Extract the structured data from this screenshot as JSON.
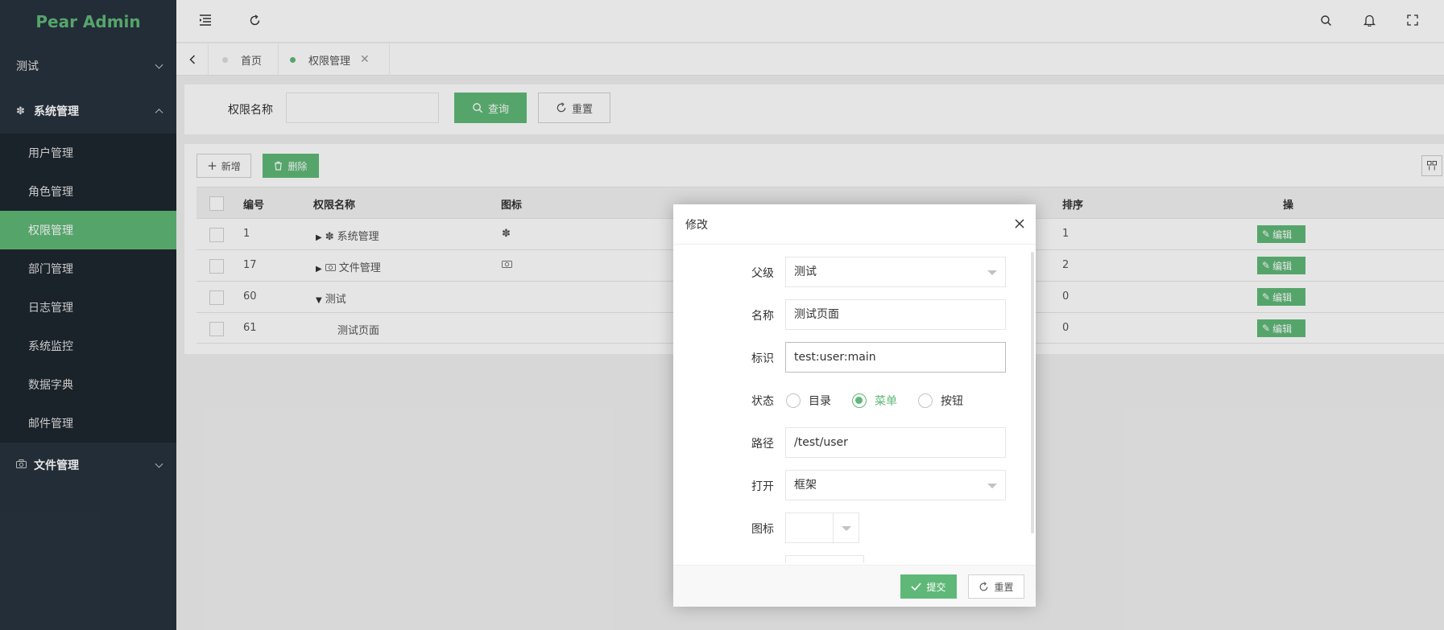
{
  "sidebar": {
    "logo": "Pear Admin",
    "groups": [
      {
        "label": "测试",
        "icon": "none"
      },
      {
        "label": "系统管理",
        "icon": "gear-icon"
      },
      {
        "label": "文件管理",
        "icon": "camera-icon"
      }
    ],
    "items": [
      "用户管理",
      "角色管理",
      "权限管理",
      "部门管理",
      "日志管理",
      "系统监控",
      "数据字典",
      "邮件管理"
    ],
    "active_item": "权限管理"
  },
  "header": {
    "icons": [
      "menu-toggle-icon",
      "refresh-icon",
      "search-icon",
      "bell-icon",
      "fullscreen-icon"
    ]
  },
  "tabs": [
    {
      "label": "首页",
      "active": false
    },
    {
      "label": "权限管理",
      "active": true
    }
  ],
  "search": {
    "label": "权限名称",
    "value": "",
    "query_label": "查询",
    "reset_label": "重置"
  },
  "toolbar": {
    "add_label": "新增",
    "delete_label": "删除"
  },
  "table": {
    "headers": [
      "编号",
      "权限名称",
      "图标",
      "排序",
      "操"
    ],
    "rows": [
      {
        "id": "1",
        "name": "系统管理",
        "icon": "gear-icon",
        "sort": "1",
        "action": "编辑"
      },
      {
        "id": "17",
        "name": "文件管理",
        "icon": "camera-icon",
        "sort": "2",
        "action": "编辑"
      },
      {
        "id": "60",
        "name": "测试",
        "icon": "",
        "sort": "0",
        "action": "编辑"
      },
      {
        "id": "61",
        "name": "测试页面",
        "icon": "",
        "sort": "0",
        "action": "编辑"
      }
    ]
  },
  "modal": {
    "title": "修改",
    "fields": {
      "parent": {
        "label": "父级",
        "value": "测试"
      },
      "name": {
        "label": "名称",
        "value": "测试页面"
      },
      "code": {
        "label": "标识",
        "value": "test:user:main"
      },
      "status": {
        "label": "状态",
        "options": [
          "目录",
          "菜单",
          "按钮"
        ],
        "selected": "菜单"
      },
      "path": {
        "label": "路径",
        "value": "/test/user"
      },
      "open": {
        "label": "打开",
        "value": "框架"
      },
      "icon": {
        "label": "图标",
        "value": ""
      }
    },
    "submit_label": "提交",
    "reset_label": "重置"
  },
  "colors": {
    "accent": "#5fb878",
    "sidebar_bg": "#28333e",
    "submenu_bg": "#1e262f"
  }
}
